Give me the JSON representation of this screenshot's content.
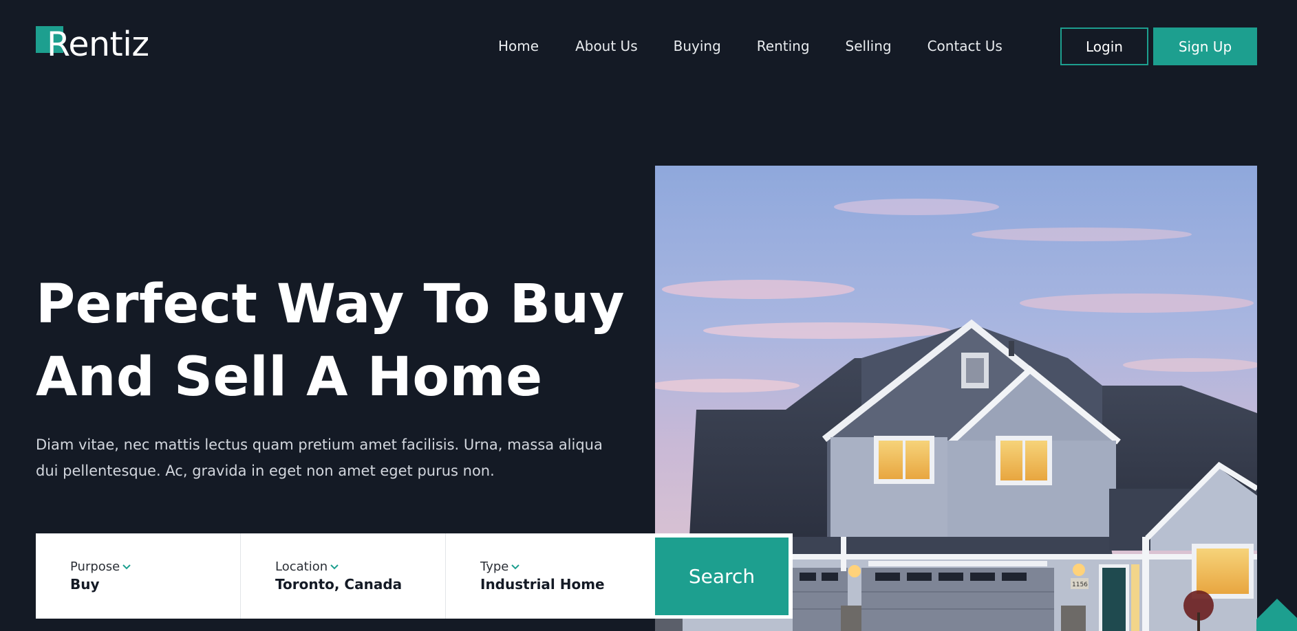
{
  "brand": {
    "name": "Rentiz"
  },
  "nav": {
    "items": [
      "Home",
      "About Us",
      "Buying",
      "Renting",
      "Selling",
      "Contact Us"
    ]
  },
  "auth": {
    "login_label": "Login",
    "signup_label": "Sign Up"
  },
  "hero": {
    "title_line1": "Perfect Way To Buy",
    "title_line2": "And Sell A Home",
    "desc_line1": "Diam vitae, nec mattis lectus quam pretium amet facilisis. Urna, massa aliqua",
    "desc_line2": "dui pellentesque. Ac, gravida in eget non amet eget purus non."
  },
  "search": {
    "fields": [
      {
        "label": "Purpose",
        "value": "Buy"
      },
      {
        "label": "Location",
        "value": "Toronto, Canada"
      },
      {
        "label": "Type",
        "value": "Industrial Home"
      }
    ],
    "button_label": "Search"
  },
  "house_image": {
    "number_plate": "1156"
  },
  "colors": {
    "background": "#141a25",
    "accent": "#1d9f8f",
    "text": "#ffffff",
    "muted_text": "#d3d7de"
  },
  "icons": {
    "dropdown": "chevron-down-icon",
    "corner": "triangle-decoration"
  }
}
